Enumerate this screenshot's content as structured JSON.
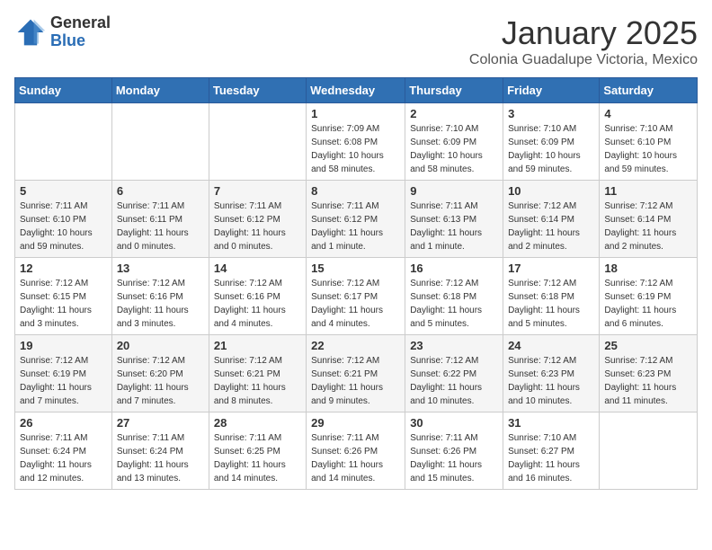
{
  "header": {
    "logo_general": "General",
    "logo_blue": "Blue",
    "month_title": "January 2025",
    "location": "Colonia Guadalupe Victoria, Mexico"
  },
  "weekdays": [
    "Sunday",
    "Monday",
    "Tuesday",
    "Wednesday",
    "Thursday",
    "Friday",
    "Saturday"
  ],
  "weeks": [
    [
      {
        "day": "",
        "info": ""
      },
      {
        "day": "",
        "info": ""
      },
      {
        "day": "",
        "info": ""
      },
      {
        "day": "1",
        "info": "Sunrise: 7:09 AM\nSunset: 6:08 PM\nDaylight: 10 hours and 58 minutes."
      },
      {
        "day": "2",
        "info": "Sunrise: 7:10 AM\nSunset: 6:09 PM\nDaylight: 10 hours and 58 minutes."
      },
      {
        "day": "3",
        "info": "Sunrise: 7:10 AM\nSunset: 6:09 PM\nDaylight: 10 hours and 59 minutes."
      },
      {
        "day": "4",
        "info": "Sunrise: 7:10 AM\nSunset: 6:10 PM\nDaylight: 10 hours and 59 minutes."
      }
    ],
    [
      {
        "day": "5",
        "info": "Sunrise: 7:11 AM\nSunset: 6:10 PM\nDaylight: 10 hours and 59 minutes."
      },
      {
        "day": "6",
        "info": "Sunrise: 7:11 AM\nSunset: 6:11 PM\nDaylight: 11 hours and 0 minutes."
      },
      {
        "day": "7",
        "info": "Sunrise: 7:11 AM\nSunset: 6:12 PM\nDaylight: 11 hours and 0 minutes."
      },
      {
        "day": "8",
        "info": "Sunrise: 7:11 AM\nSunset: 6:12 PM\nDaylight: 11 hours and 1 minute."
      },
      {
        "day": "9",
        "info": "Sunrise: 7:11 AM\nSunset: 6:13 PM\nDaylight: 11 hours and 1 minute."
      },
      {
        "day": "10",
        "info": "Sunrise: 7:12 AM\nSunset: 6:14 PM\nDaylight: 11 hours and 2 minutes."
      },
      {
        "day": "11",
        "info": "Sunrise: 7:12 AM\nSunset: 6:14 PM\nDaylight: 11 hours and 2 minutes."
      }
    ],
    [
      {
        "day": "12",
        "info": "Sunrise: 7:12 AM\nSunset: 6:15 PM\nDaylight: 11 hours and 3 minutes."
      },
      {
        "day": "13",
        "info": "Sunrise: 7:12 AM\nSunset: 6:16 PM\nDaylight: 11 hours and 3 minutes."
      },
      {
        "day": "14",
        "info": "Sunrise: 7:12 AM\nSunset: 6:16 PM\nDaylight: 11 hours and 4 minutes."
      },
      {
        "day": "15",
        "info": "Sunrise: 7:12 AM\nSunset: 6:17 PM\nDaylight: 11 hours and 4 minutes."
      },
      {
        "day": "16",
        "info": "Sunrise: 7:12 AM\nSunset: 6:18 PM\nDaylight: 11 hours and 5 minutes."
      },
      {
        "day": "17",
        "info": "Sunrise: 7:12 AM\nSunset: 6:18 PM\nDaylight: 11 hours and 5 minutes."
      },
      {
        "day": "18",
        "info": "Sunrise: 7:12 AM\nSunset: 6:19 PM\nDaylight: 11 hours and 6 minutes."
      }
    ],
    [
      {
        "day": "19",
        "info": "Sunrise: 7:12 AM\nSunset: 6:19 PM\nDaylight: 11 hours and 7 minutes."
      },
      {
        "day": "20",
        "info": "Sunrise: 7:12 AM\nSunset: 6:20 PM\nDaylight: 11 hours and 7 minutes."
      },
      {
        "day": "21",
        "info": "Sunrise: 7:12 AM\nSunset: 6:21 PM\nDaylight: 11 hours and 8 minutes."
      },
      {
        "day": "22",
        "info": "Sunrise: 7:12 AM\nSunset: 6:21 PM\nDaylight: 11 hours and 9 minutes."
      },
      {
        "day": "23",
        "info": "Sunrise: 7:12 AM\nSunset: 6:22 PM\nDaylight: 11 hours and 10 minutes."
      },
      {
        "day": "24",
        "info": "Sunrise: 7:12 AM\nSunset: 6:23 PM\nDaylight: 11 hours and 10 minutes."
      },
      {
        "day": "25",
        "info": "Sunrise: 7:12 AM\nSunset: 6:23 PM\nDaylight: 11 hours and 11 minutes."
      }
    ],
    [
      {
        "day": "26",
        "info": "Sunrise: 7:11 AM\nSunset: 6:24 PM\nDaylight: 11 hours and 12 minutes."
      },
      {
        "day": "27",
        "info": "Sunrise: 7:11 AM\nSunset: 6:24 PM\nDaylight: 11 hours and 13 minutes."
      },
      {
        "day": "28",
        "info": "Sunrise: 7:11 AM\nSunset: 6:25 PM\nDaylight: 11 hours and 14 minutes."
      },
      {
        "day": "29",
        "info": "Sunrise: 7:11 AM\nSunset: 6:26 PM\nDaylight: 11 hours and 14 minutes."
      },
      {
        "day": "30",
        "info": "Sunrise: 7:11 AM\nSunset: 6:26 PM\nDaylight: 11 hours and 15 minutes."
      },
      {
        "day": "31",
        "info": "Sunrise: 7:10 AM\nSunset: 6:27 PM\nDaylight: 11 hours and 16 minutes."
      },
      {
        "day": "",
        "info": ""
      }
    ]
  ]
}
